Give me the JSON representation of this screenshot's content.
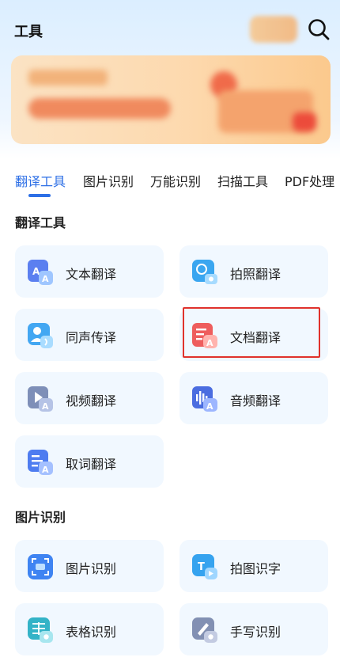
{
  "header": {
    "title": "工具"
  },
  "tabs": [
    {
      "label": "翻译工具",
      "active": true
    },
    {
      "label": "图片识别",
      "active": false
    },
    {
      "label": "万能识别",
      "active": false
    },
    {
      "label": "扫描工具",
      "active": false
    },
    {
      "label": "PDF处理",
      "active": false
    }
  ],
  "sections": [
    {
      "title": "翻译工具",
      "items": [
        {
          "label": "文本翻译",
          "icon": "text-translate-icon"
        },
        {
          "label": "拍照翻译",
          "icon": "photo-translate-icon"
        },
        {
          "label": "同声传译",
          "icon": "simultaneous-interpret-icon"
        },
        {
          "label": "文档翻译",
          "icon": "document-translate-icon",
          "highlighted": true
        },
        {
          "label": "视频翻译",
          "icon": "video-translate-icon"
        },
        {
          "label": "音频翻译",
          "icon": "audio-translate-icon"
        },
        {
          "label": "取词翻译",
          "icon": "word-pick-translate-icon"
        }
      ]
    },
    {
      "title": "图片识别",
      "items": [
        {
          "label": "图片识别",
          "icon": "image-recognize-icon"
        },
        {
          "label": "拍图识字",
          "icon": "photo-ocr-icon"
        },
        {
          "label": "表格识别",
          "icon": "table-recognize-icon"
        },
        {
          "label": "手写识别",
          "icon": "handwriting-recognize-icon"
        }
      ]
    }
  ],
  "colors": {
    "accent": "#2d6fe6",
    "card_bg": "#f1f8ff",
    "highlight_border": "#e0322c"
  }
}
